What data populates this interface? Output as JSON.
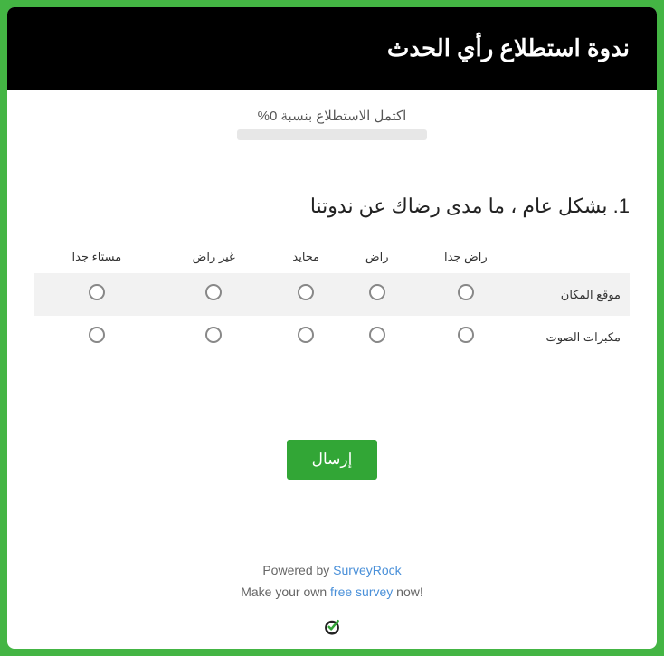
{
  "header": {
    "title": "ندوة استطلاع رأي الحدث"
  },
  "progress": {
    "text": "اكتمل الاستطلاع بنسبة 0%"
  },
  "question": {
    "title": "1. بشكل عام ، ما مدى رضاك عن ندوتنا",
    "columns": [
      "راض جدا",
      "راض",
      "محايد",
      "غير راض",
      "مستاء جدا"
    ],
    "rows": [
      "موقع المكان",
      "مكبرات الصوت"
    ]
  },
  "submit": {
    "label": "إرسال"
  },
  "footer": {
    "powered_prefix": "Powered by ",
    "powered_link": "SurveyRock",
    "make_prefix": "Make your own ",
    "make_link": "free survey",
    "make_suffix": " now!"
  }
}
